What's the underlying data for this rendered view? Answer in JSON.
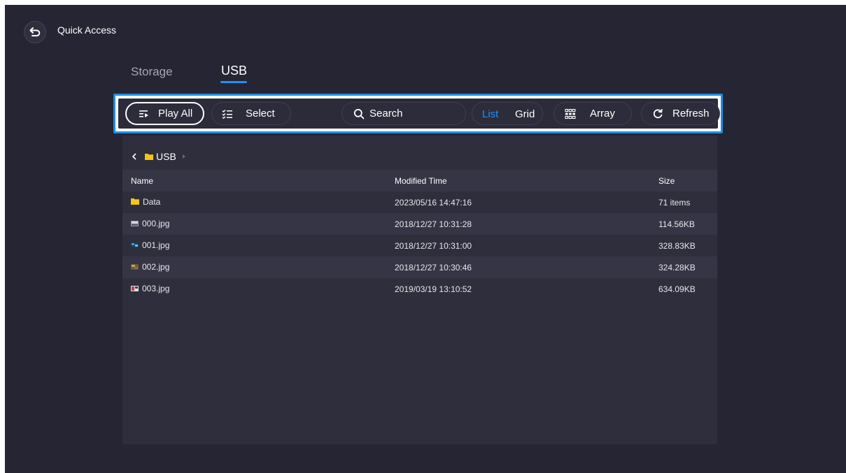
{
  "header": {
    "title": "Quick Access",
    "back_icon": "return-arrow-icon"
  },
  "tabs": [
    {
      "label": "Storage",
      "active": false
    },
    {
      "label": "USB",
      "active": true
    }
  ],
  "toolbar": {
    "play_all": "Play All",
    "select": "Select",
    "search": "Search",
    "list": "List",
    "grid": "Grid",
    "array": "Array",
    "refresh": "Refresh"
  },
  "breadcrumb": {
    "current": "USB"
  },
  "columns": {
    "name": "Name",
    "modified": "Modified Time",
    "size": "Size"
  },
  "rows": [
    {
      "name": "Data",
      "modified": "2023/05/16 14:47:16",
      "size": "71 items",
      "icon": "folder-icon"
    },
    {
      "name": "000.jpg",
      "modified": "2018/12/27 10:31:28",
      "size": "114.56KB",
      "icon": "image-thumb-icon"
    },
    {
      "name": "001.jpg",
      "modified": "2018/12/27 10:31:00",
      "size": "328.83KB",
      "icon": "image-thumb-icon"
    },
    {
      "name": "002.jpg",
      "modified": "2018/12/27 10:30:46",
      "size": "324.28KB",
      "icon": "image-thumb-icon"
    },
    {
      "name": "003.jpg",
      "modified": "2019/03/19 13:10:52",
      "size": "634.09KB",
      "icon": "image-thumb-icon"
    }
  ],
  "colors": {
    "accent": "#1e90ff",
    "background": "#252533",
    "panel": "#2e2e3c",
    "folder": "#f5c518"
  }
}
